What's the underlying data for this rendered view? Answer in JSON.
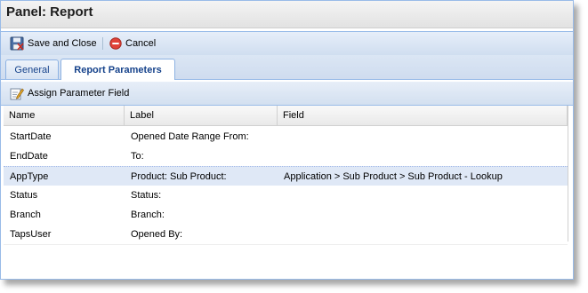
{
  "panel": {
    "title": "Panel: Report"
  },
  "toolbar": {
    "save_close_label": "Save and Close",
    "cancel_label": "Cancel",
    "save_icon": "save-disk-icon",
    "cancel_icon": "cancel-circle-icon"
  },
  "tabs": [
    {
      "label": "General",
      "active": false
    },
    {
      "label": "Report Parameters",
      "active": true
    }
  ],
  "subtoolbar": {
    "assign_label": "Assign Parameter Field",
    "assign_icon": "pencil-edit-icon"
  },
  "grid": {
    "columns": [
      "Name",
      "Label",
      "Field"
    ],
    "rows": [
      {
        "name": "StartDate",
        "label": "Opened Date Range From:",
        "field": ""
      },
      {
        "name": "EndDate",
        "label": "To:",
        "field": ""
      },
      {
        "name": "AppType",
        "label": "Product: Sub Product:",
        "field": "Application > Sub Product > Sub Product - Lookup",
        "selected": true
      },
      {
        "name": "Status",
        "label": "Status:",
        "field": ""
      },
      {
        "name": "Branch",
        "label": "Branch:",
        "field": ""
      },
      {
        "name": "TapsUser",
        "label": "Opened By:",
        "field": ""
      }
    ]
  },
  "colors": {
    "border": "#99bbe8",
    "tab_text": "#15428b",
    "selected_row": "#dfe8f6"
  }
}
